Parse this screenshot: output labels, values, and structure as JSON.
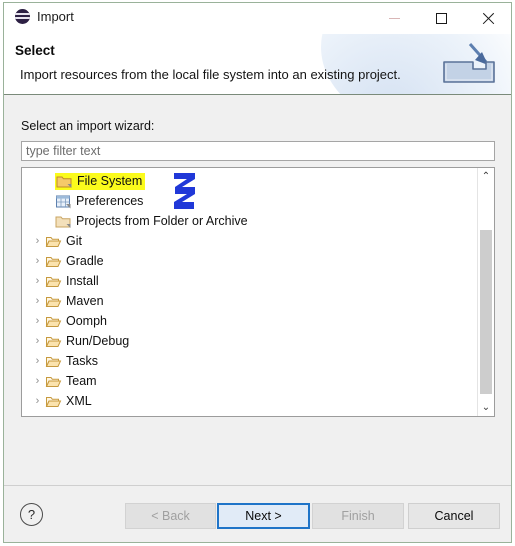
{
  "window": {
    "title": "Import",
    "icon": "eclipse-icon",
    "controls": {
      "minimize": "minimize-icon",
      "maximize": "maximize-icon",
      "close": "close-icon"
    }
  },
  "header": {
    "title": "Select",
    "description": "Import resources from the local file system into an existing project.",
    "icon": "import-tray-icon"
  },
  "body": {
    "wizard_label": "Select an import wizard:",
    "filter": {
      "value": "",
      "placeholder": "type filter text"
    },
    "tree": [
      {
        "label": "File System",
        "icon": "folder-import-icon",
        "level": "child",
        "expandable": false,
        "highlighted": true
      },
      {
        "label": "Preferences",
        "icon": "preferences-icon",
        "level": "child",
        "expandable": false,
        "highlighted": false
      },
      {
        "label": "Projects from Folder or Archive",
        "icon": "folder-import-icon",
        "level": "child",
        "expandable": false,
        "highlighted": false
      },
      {
        "label": "Git",
        "icon": "folder-open-icon",
        "level": "root",
        "expandable": true,
        "highlighted": false
      },
      {
        "label": "Gradle",
        "icon": "folder-open-icon",
        "level": "root",
        "expandable": true,
        "highlighted": false
      },
      {
        "label": "Install",
        "icon": "folder-open-icon",
        "level": "root",
        "expandable": true,
        "highlighted": false
      },
      {
        "label": "Maven",
        "icon": "folder-open-icon",
        "level": "root",
        "expandable": true,
        "highlighted": false
      },
      {
        "label": "Oomph",
        "icon": "folder-open-icon",
        "level": "root",
        "expandable": true,
        "highlighted": false
      },
      {
        "label": "Run/Debug",
        "icon": "folder-open-icon",
        "level": "root",
        "expandable": true,
        "highlighted": false
      },
      {
        "label": "Tasks",
        "icon": "folder-open-icon",
        "level": "root",
        "expandable": true,
        "highlighted": false
      },
      {
        "label": "Team",
        "icon": "folder-open-icon",
        "level": "root",
        "expandable": true,
        "highlighted": false
      },
      {
        "label": "XML",
        "icon": "folder-open-icon",
        "level": "root",
        "expandable": true,
        "highlighted": false
      }
    ],
    "expand_chevron": "›",
    "scrollbar": {
      "up_arrow": "⌃",
      "down_arrow": "⌄"
    }
  },
  "annotation": {
    "number": "3",
    "color": "#2038d8",
    "highlight_color": "#fbfb1c"
  },
  "footer": {
    "help": "?",
    "buttons": [
      {
        "label": "< Back",
        "state": "disabled"
      },
      {
        "label": "Next >",
        "state": "focused"
      },
      {
        "label": "Finish",
        "state": "disabled"
      },
      {
        "label": "Cancel",
        "state": "enabled"
      }
    ]
  }
}
